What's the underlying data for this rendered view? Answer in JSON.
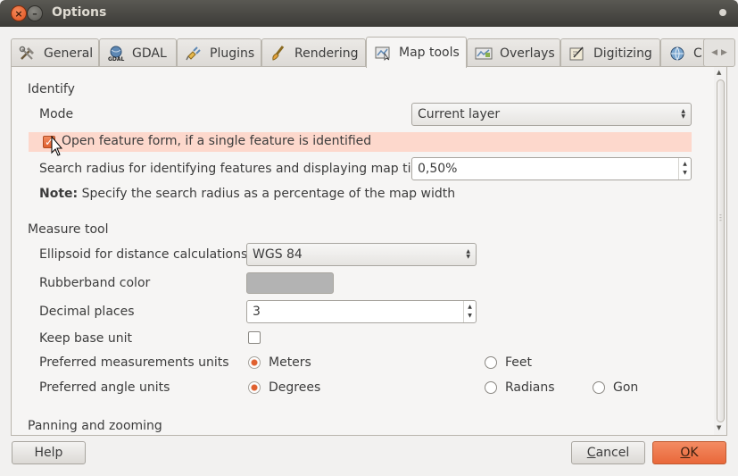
{
  "window": {
    "title": "Options"
  },
  "tabs": [
    {
      "label": "General",
      "icon": "tools-icon"
    },
    {
      "label": "GDAL",
      "icon": "gdal-icon"
    },
    {
      "label": "Plugins",
      "icon": "plugin-icon"
    },
    {
      "label": "Rendering",
      "icon": "brush-icon"
    },
    {
      "label": "Map tools",
      "icon": "map-tools-icon",
      "active": true
    },
    {
      "label": "Overlays",
      "icon": "overlays-icon"
    },
    {
      "label": "Digitizing",
      "icon": "digitizing-icon"
    },
    {
      "label": "C",
      "icon": "globe-icon"
    }
  ],
  "identify": {
    "section_title": "Identify",
    "mode_label": "Mode",
    "mode_value": "Current layer",
    "open_form_label": "Open feature form, if a single feature is identified",
    "open_form_checked": true,
    "search_radius_label": "Search radius for identifying features and displaying map tips",
    "search_radius_value": "0,50%",
    "note_bold": "Note:",
    "note_text": " Specify the search radius as a percentage of the map width"
  },
  "measure": {
    "section_title": "Measure tool",
    "ellipsoid_label": "Ellipsoid for distance calculations",
    "ellipsoid_value": "WGS 84",
    "rubberband_label": "Rubberband color",
    "rubberband_color": "#b3b3b3",
    "decimal_label": "Decimal places",
    "decimal_value": "3",
    "keep_base_label": "Keep base unit",
    "keep_base_checked": false,
    "pref_units_label": "Preferred measurements units",
    "unit_meters": "Meters",
    "unit_feet": "Feet",
    "pref_angle_label": "Preferred angle units",
    "angle_degrees": "Degrees",
    "angle_radians": "Radians",
    "angle_gon": "Gon"
  },
  "panning": {
    "section_title": "Panning and zooming"
  },
  "buttons": {
    "help": "Help",
    "cancel_first": "C",
    "cancel_rest": "ancel",
    "ok_first": "O",
    "ok_rest": "K"
  },
  "colors": {
    "accent": "#e9683a",
    "highlight_row": "#fdd8cc",
    "titlebar": "#3c3b37"
  }
}
